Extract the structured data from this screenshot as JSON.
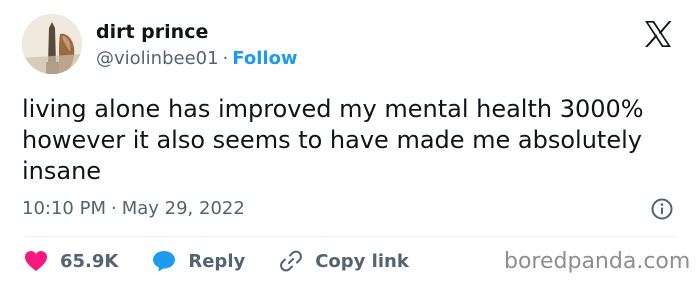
{
  "author": {
    "display_name": "dirt prince",
    "handle": "@violinbee01",
    "separator": "·",
    "follow_label": "Follow"
  },
  "platform_logo": "x-logo-icon",
  "tweet": {
    "text": "living alone has improved my mental health 3000% however it also seems to have made me absolutely insane"
  },
  "meta": {
    "time": "10:10 PM",
    "separator": "·",
    "date": "May 29, 2022"
  },
  "actions": {
    "like_count": "65.9K",
    "reply_label": "Reply",
    "copy_link_label": "Copy link"
  },
  "watermark": "boredpanda.com",
  "colors": {
    "link_blue": "#1d9bf0",
    "like_pink": "#f91880",
    "secondary_text": "#536471",
    "primary_text": "#0f1419"
  }
}
